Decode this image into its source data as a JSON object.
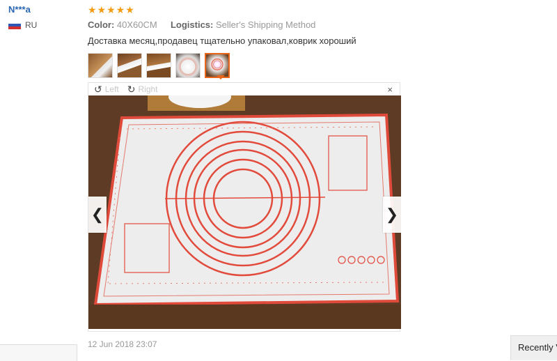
{
  "reviewer": {
    "name": "N***a",
    "country": "RU"
  },
  "review": {
    "rating": 5,
    "stars_text": "★★★★★",
    "color_label": "Color:",
    "color_value": "40X60CM",
    "logistics_label": "Logistics:",
    "logistics_value": "Seller's Shipping Method",
    "text": "Доставка месяц,продавец тщательно упаковал,коврик хороший",
    "thumbnail_count": 5,
    "active_thumbnail": 5,
    "date": "12 Jun 2018 23:07"
  },
  "viewer": {
    "rotate_left_icon": "↺",
    "rotate_left_label": "Left",
    "rotate_right_icon": "↻",
    "rotate_right_label": "Right",
    "close_icon": "×",
    "prev_icon": "❮",
    "next_icon": "❯"
  },
  "recently_viewed": {
    "label": "Recently V"
  },
  "colors": {
    "accent": "#e8651a",
    "link": "#2a66b3",
    "star": "#f39c12"
  }
}
